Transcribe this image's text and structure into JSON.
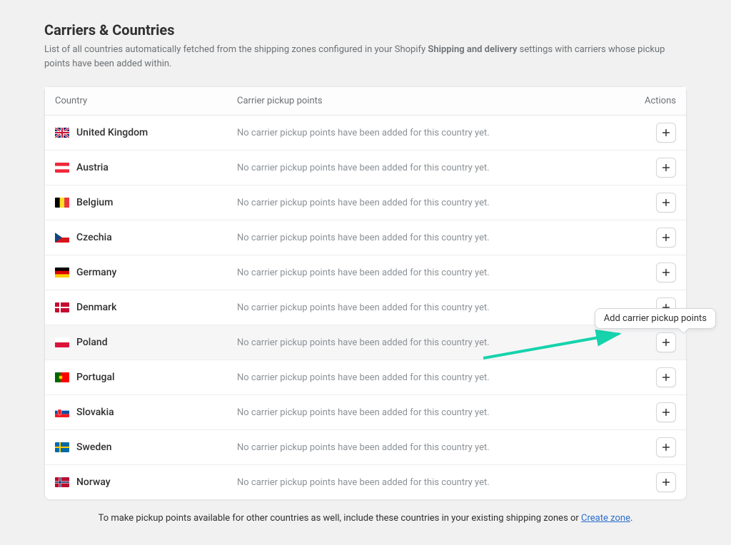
{
  "header": {
    "title": "Carriers & Countries",
    "descriptionPrefix": "List of all countries automatically fetched from the shipping zones configured in your Shopify ",
    "descriptionStrong": "Shipping and delivery",
    "descriptionSuffix": " settings with carriers whose pickup points have been added within."
  },
  "table": {
    "columns": {
      "country": "Country",
      "carrier": "Carrier pickup points",
      "actions": "Actions"
    },
    "emptyState": "No carrier pickup points have been added for this country yet.",
    "rows": [
      {
        "name": "United Kingdom",
        "code": "gb"
      },
      {
        "name": "Austria",
        "code": "at"
      },
      {
        "name": "Belgium",
        "code": "be"
      },
      {
        "name": "Czechia",
        "code": "cz"
      },
      {
        "name": "Germany",
        "code": "de"
      },
      {
        "name": "Denmark",
        "code": "dk"
      },
      {
        "name": "Poland",
        "code": "pl"
      },
      {
        "name": "Portugal",
        "code": "pt"
      },
      {
        "name": "Slovakia",
        "code": "sk"
      },
      {
        "name": "Sweden",
        "code": "se"
      },
      {
        "name": "Norway",
        "code": "no"
      }
    ],
    "highlightedIndex": 6
  },
  "tooltip": {
    "text": "Add carrier pickup points",
    "forIndex": 6
  },
  "footer": {
    "text": "To make pickup points available for other countries as well, include these countries in your existing shipping zones or ",
    "linkText": "Create zone",
    "suffix": "."
  }
}
